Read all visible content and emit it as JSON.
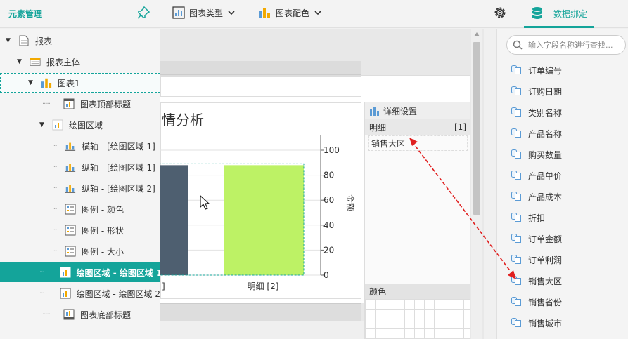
{
  "toolbar": {
    "title": "元素管理",
    "chart_type_label": "图表类型",
    "chart_color_label": "图表配色",
    "data_binding_label": "数据绑定"
  },
  "tree": {
    "items": [
      {
        "label": "报表"
      },
      {
        "label": "报表主体"
      },
      {
        "label": "图表1"
      },
      {
        "label": "图表顶部标题"
      },
      {
        "label": "绘图区域"
      },
      {
        "label": "横轴 - [绘图区域 1]"
      },
      {
        "label": "纵轴 - [绘图区域 1]"
      },
      {
        "label": "纵轴 - [绘图区域 2]"
      },
      {
        "label": "图例 - 颜色"
      },
      {
        "label": "图例 - 形状"
      },
      {
        "label": "图例 - 大小"
      },
      {
        "label": "绘图区域 - 绘图区域 1"
      },
      {
        "label": "绘图区域 - 绘图区域 2"
      },
      {
        "label": "图表底部标题"
      }
    ]
  },
  "chart": {
    "title_fragment": "情分析",
    "y_axis_label": "金额",
    "y_ticks": [
      "100",
      "80",
      "60",
      "40",
      "20",
      "0"
    ],
    "x_labels": [
      "]",
      "明细 [2]"
    ],
    "bar_colors": [
      "#4e5f70",
      "#bdf265"
    ]
  },
  "chart_data": {
    "type": "bar",
    "categories": [
      "",
      "明细 [2]"
    ],
    "values": [
      88,
      88
    ],
    "ylabel": "金额",
    "ylim": [
      0,
      100
    ]
  },
  "detail": {
    "header": "详细设置",
    "section": "明细",
    "count": "[1]",
    "field": "销售大区",
    "color_section": "颜色"
  },
  "fields": {
    "search_placeholder": "输入字段名称进行查找...",
    "items": [
      {
        "label": "订单编号"
      },
      {
        "label": "订购日期"
      },
      {
        "label": "类别名称"
      },
      {
        "label": "产品名称"
      },
      {
        "label": "购买数量"
      },
      {
        "label": "产品单价"
      },
      {
        "label": "产品成本"
      },
      {
        "label": "折扣"
      },
      {
        "label": "订单金额"
      },
      {
        "label": "订单利润"
      },
      {
        "label": "销售大区"
      },
      {
        "label": "销售省份"
      },
      {
        "label": "销售城市"
      }
    ]
  },
  "colors": {
    "accent": "#14a49a",
    "arrow": "#e02020"
  }
}
